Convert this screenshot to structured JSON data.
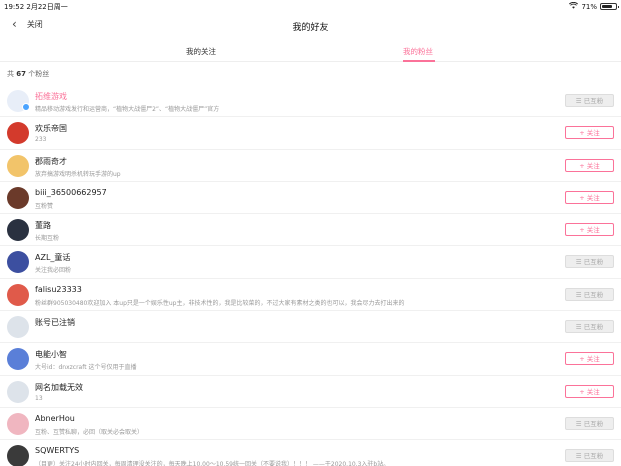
{
  "status_bar": {
    "time_date": "19:52  2月22日周一",
    "battery": "71%",
    "wifi_icon": "wifi-icon"
  },
  "nav": {
    "back_label": "关闭",
    "title": "我的好友"
  },
  "tabs": [
    {
      "label": "我的关注"
    },
    {
      "label": "我的粉丝",
      "active": true
    }
  ],
  "summary": {
    "prefix": "共",
    "count": "67",
    "suffix": "个粉丝"
  },
  "colors": {
    "accent": "#fb7299"
  },
  "fans": [
    {
      "name": "拓维游戏",
      "desc": "精品移动游戏发行和运营商，“植物大战僵尸2”、“植物大战僵尸”官方",
      "button": "☰ 已互粉",
      "state": "mutual",
      "avatar_color": "#e8eef8",
      "verified": true
    },
    {
      "name": "欢乐帝国",
      "desc": "233",
      "button": "+ 关注",
      "state": "follow",
      "avatar_color": "#d33a2c"
    },
    {
      "name": "郡雨奇才",
      "desc": "放弃搞游戏明杀机转玩手游的up",
      "button": "+ 关注",
      "state": "follow",
      "avatar_color": "#f2c46a"
    },
    {
      "name": "biii_36500662957",
      "desc": "互粉赞",
      "button": "+ 关注",
      "state": "follow",
      "avatar_color": "#6b3a2a"
    },
    {
      "name": "董路",
      "desc": "长期互粉",
      "button": "+ 关注",
      "state": "follow",
      "avatar_color": "#2a3140"
    },
    {
      "name": "AZL_童话",
      "desc": "关注我必回粉",
      "button": "☰ 已互粉",
      "state": "mutual",
      "avatar_color": "#3c4fa0"
    },
    {
      "name": "falisu23333",
      "desc": "粉丝群905030480欢迎加入 本up只是一个娱乐性up主，非技术性的，我是比较菜的，不过大家有素材之类的也可以，我会尽力去打出来的",
      "button": "☰ 已互粉",
      "state": "mutual",
      "avatar_color": "#e05a4a"
    },
    {
      "name": "账号已注销",
      "desc": "",
      "button": "☰ 已互粉",
      "state": "mutual",
      "avatar_color": "#dde3ea"
    },
    {
      "name": "电能小智",
      "desc": "大号id：dnxzcraft 这个号仅用于直播",
      "button": "+ 关注",
      "state": "follow",
      "avatar_color": "#5a7fd8"
    },
    {
      "name": "网名加载无效",
      "desc": "13",
      "button": "+ 关注",
      "state": "follow",
      "avatar_color": "#dde3ea"
    },
    {
      "name": "AbnerHou",
      "desc": "互粉、互赞私聊，必回（取关必会取关）",
      "button": "☰ 已互粉",
      "state": "mutual",
      "avatar_color": "#f0b6c0"
    },
    {
      "name": "SQWERTYS",
      "desc": "（目更）关注24小时内回关，每周清理没关注的，每天晚上10.00～10.59统一回关（不要说我）！！！ ——于2020.10.3入驻b站。",
      "button": "☰ 已互粉",
      "state": "mutual",
      "avatar_color": "#3a3a3a"
    }
  ]
}
